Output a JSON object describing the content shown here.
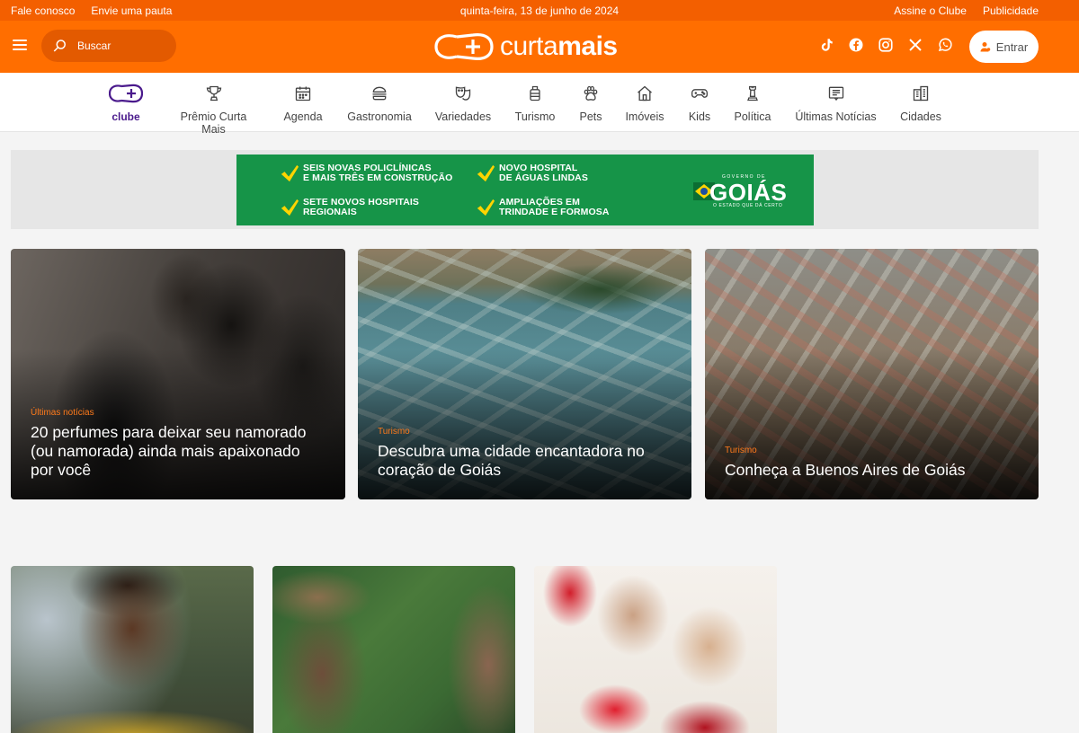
{
  "topbar": {
    "links_left": [
      "Fale conosco",
      "Envie uma pauta"
    ],
    "date": "quinta-feira, 13 de junho de 2024",
    "links_right": [
      "Assine o Clube",
      "Publicidade"
    ]
  },
  "header": {
    "search_placeholder": "Buscar",
    "logo_text_light": "curta",
    "logo_text_bold": "mais",
    "social_icons": [
      "tiktok-icon",
      "facebook-icon",
      "instagram-icon",
      "x-icon",
      "whatsapp-icon"
    ],
    "login_label": "Entrar"
  },
  "nav": {
    "items": [
      {
        "label": "clube",
        "icon": "clube-icon"
      },
      {
        "label": "Prêmio Curta Mais",
        "icon": "trophy-icon"
      },
      {
        "label": "Agenda",
        "icon": "calendar-icon"
      },
      {
        "label": "Gastronomia",
        "icon": "burger-icon"
      },
      {
        "label": "Variedades",
        "icon": "masks-icon"
      },
      {
        "label": "Turismo",
        "icon": "luggage-icon"
      },
      {
        "label": "Pets",
        "icon": "paw-icon"
      },
      {
        "label": "Imóveis",
        "icon": "house-icon"
      },
      {
        "label": "Kids",
        "icon": "gamepad-icon"
      },
      {
        "label": "Política",
        "icon": "chess-icon"
      },
      {
        "label": "Últimas Notícias",
        "icon": "news-icon"
      },
      {
        "label": "Cidades",
        "icon": "buildings-icon"
      }
    ]
  },
  "banner": {
    "items": [
      {
        "line1": "SEIS NOVAS POLICLÍNICAS",
        "line2": "E MAIS TRÊS EM CONSTRUÇÃO"
      },
      {
        "line1": "NOVO HOSPITAL",
        "line2": "DE ÁGUAS LINDAS"
      },
      {
        "line1": "SETE NOVOS HOSPITAIS",
        "line2": "REGIONAIS"
      },
      {
        "line1": "AMPLIAÇÕES EM",
        "line2": "TRINDADE E FORMOSA"
      }
    ],
    "brand_top": "GOVERNO DE",
    "brand": "GOIÁS",
    "brand_sub": "O ESTADO QUE DÁ CERTO"
  },
  "featured": [
    {
      "category": "Últimas notícias",
      "title": "20 perfumes para deixar seu namorado (ou namorada) ainda mais apaixonado por você"
    },
    {
      "category": "Turismo",
      "title": "Descubra uma cidade encantadora no coração de Goiás"
    },
    {
      "category": "Turismo",
      "title": "Conheça a Buenos Aires de Goiás"
    }
  ],
  "colors": {
    "brand_orange": "#ff6e00",
    "topbar_orange": "#f35f00",
    "clube_purple": "#4a1a8c",
    "banner_green": "#169448",
    "category_orange": "#ff7a1a"
  }
}
